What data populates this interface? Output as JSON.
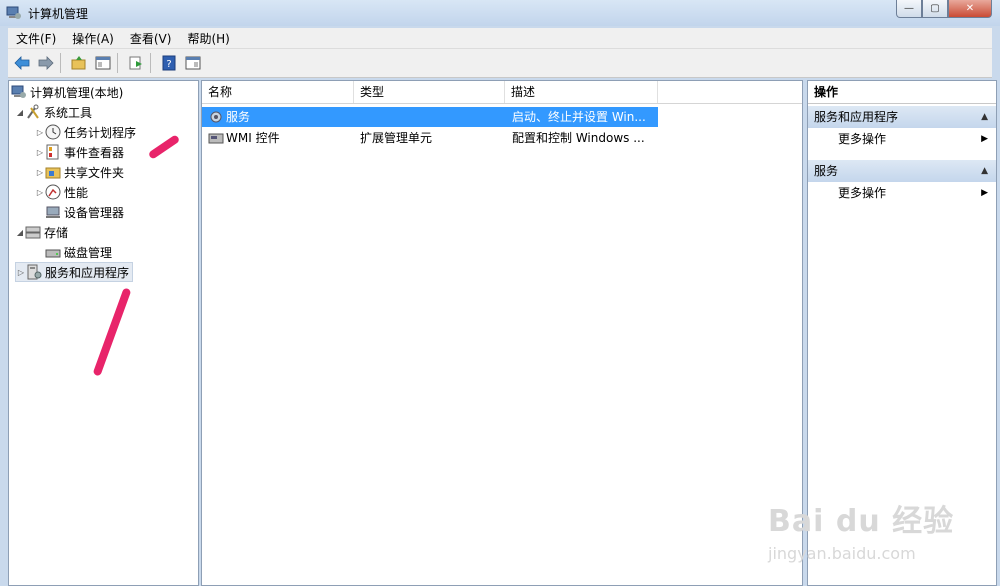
{
  "window": {
    "title": "计算机管理",
    "min": "—",
    "max": "▢",
    "close": "✕"
  },
  "menu": [
    "文件(F)",
    "操作(A)",
    "查看(V)",
    "帮助(H)"
  ],
  "tree": {
    "root": "计算机管理(本地)",
    "system_tools": "系统工具",
    "task_scheduler": "任务计划程序",
    "event_viewer": "事件查看器",
    "shared_folders": "共享文件夹",
    "performance": "性能",
    "device_manager": "设备管理器",
    "storage": "存储",
    "disk_management": "磁盘管理",
    "services_apps": "服务和应用程序"
  },
  "list": {
    "columns": [
      "名称",
      "类型",
      "描述"
    ],
    "rows": [
      {
        "name": "服务",
        "type": "",
        "desc": "启动、终止并设置 Win..."
      },
      {
        "name": "WMI 控件",
        "type": "扩展管理单元",
        "desc": "配置和控制 Windows ..."
      }
    ]
  },
  "actions": {
    "header": "操作",
    "section1": "服务和应用程序",
    "more1": "更多操作",
    "section2": "服务",
    "more2": "更多操作"
  },
  "watermark": {
    "logo": "Bai du 经验",
    "url": "jingyan.baidu.com"
  },
  "colors": {
    "selection": "#3399ff",
    "annotation": "#e8246a"
  }
}
